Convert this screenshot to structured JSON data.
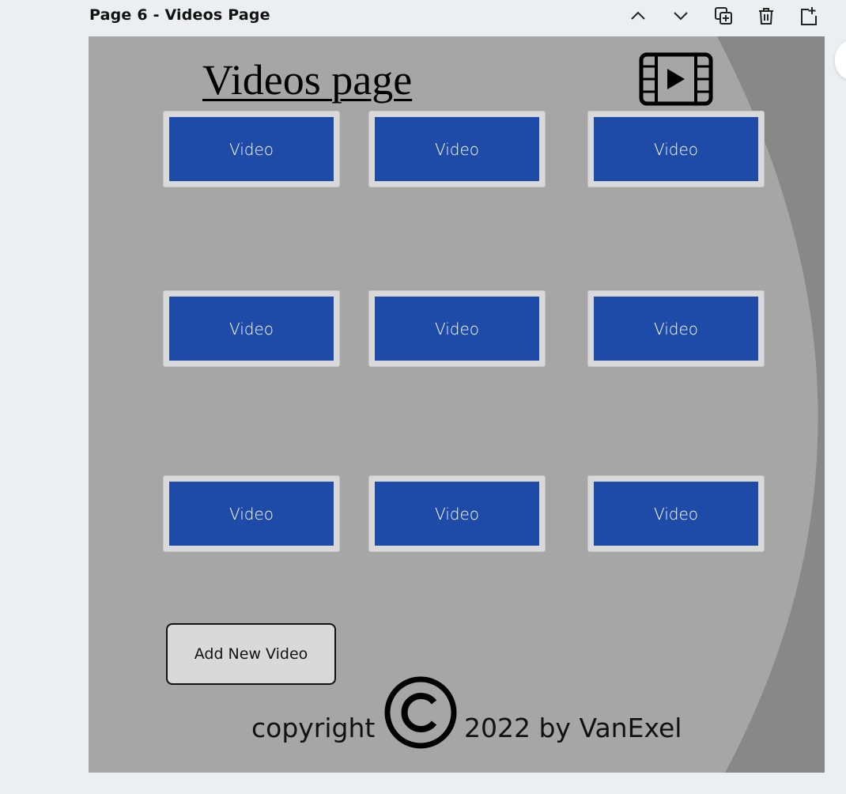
{
  "header": {
    "page_title": "Page 6 - Videos Page",
    "tools": [
      "chevron-up-icon",
      "chevron-down-icon",
      "duplicate-page-icon",
      "trash-icon",
      "add-page-icon"
    ]
  },
  "design": {
    "title": "Videos page",
    "video_cards": [
      {
        "label": "Video"
      },
      {
        "label": "Video"
      },
      {
        "label": "Video"
      },
      {
        "label": "Video"
      },
      {
        "label": "Video"
      },
      {
        "label": "Video"
      },
      {
        "label": "Video"
      },
      {
        "label": "Video"
      },
      {
        "label": "Video"
      }
    ],
    "add_button": "Add New Video",
    "footer_left": "copyright",
    "footer_right": "2022 by VanExel"
  },
  "colors": {
    "canvas_bg": "#a6a6a6",
    "arc_bg": "#888888",
    "card_frame": "#d9d9d9",
    "card_fill": "#1e4aa8"
  }
}
